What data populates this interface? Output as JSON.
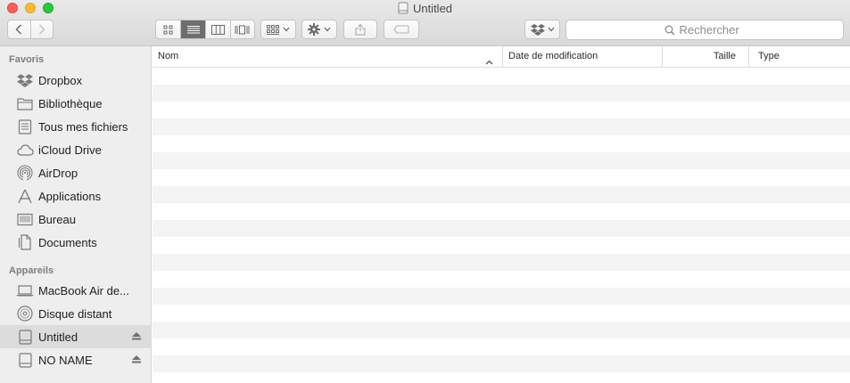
{
  "window": {
    "title": "Untitled"
  },
  "search": {
    "placeholder": "Rechercher"
  },
  "sidebar": {
    "favorites_title": "Favoris",
    "favorites": [
      {
        "label": "Dropbox",
        "icon": "dropbox-icon"
      },
      {
        "label": "Bibliothèque",
        "icon": "folder-icon"
      },
      {
        "label": "Tous mes fichiers",
        "icon": "all-files-icon"
      },
      {
        "label": "iCloud Drive",
        "icon": "cloud-icon"
      },
      {
        "label": "AirDrop",
        "icon": "airdrop-icon"
      },
      {
        "label": "Applications",
        "icon": "applications-icon"
      },
      {
        "label": "Bureau",
        "icon": "desktop-icon"
      },
      {
        "label": "Documents",
        "icon": "documents-icon"
      }
    ],
    "devices_title": "Appareils",
    "devices": [
      {
        "label": "MacBook Air de...",
        "icon": "laptop-icon"
      },
      {
        "label": "Disque distant",
        "icon": "disc-icon"
      },
      {
        "label": "Untitled",
        "icon": "drive-icon",
        "selected": true,
        "ejectable": true
      },
      {
        "label": "NO NAME",
        "icon": "drive-icon",
        "ejectable": true
      }
    ]
  },
  "list": {
    "columns": [
      "Nom",
      "Date de modification",
      "Taille",
      "Type"
    ],
    "sorted_column": "Nom"
  }
}
